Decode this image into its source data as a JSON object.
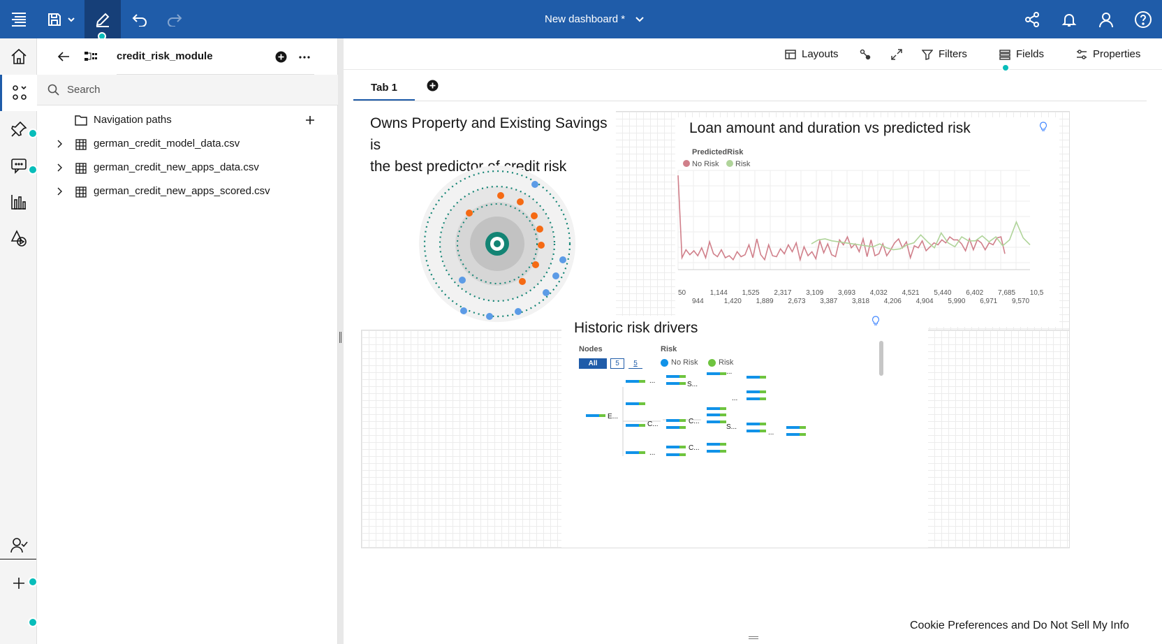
{
  "header": {
    "title": "New dashboard *"
  },
  "panel": {
    "module_name": "credit_risk_module",
    "search_placeholder": "Search",
    "tree": [
      {
        "label": "Navigation paths",
        "type": "folder"
      },
      {
        "label": "german_credit_model_data.csv",
        "type": "table"
      },
      {
        "label": "german_credit_new_apps_data.csv",
        "type": "table"
      },
      {
        "label": "german_credit_new_apps_scored.csv",
        "type": "table"
      }
    ]
  },
  "toolbar": {
    "layouts": "Layouts",
    "filters": "Filters",
    "fields": "Fields",
    "properties": "Properties"
  },
  "tabs": [
    {
      "label": "Tab 1",
      "selected": true
    }
  ],
  "widgets": {
    "insight": {
      "title_line1": "Owns Property and Existing Savings is",
      "title_line2": "the best predictor of credit risk"
    },
    "line_chart": {
      "title": "Loan amount and duration vs predicted risk",
      "legend_title": "PredictedRisk"
    },
    "drivers": {
      "title": "Historic risk drivers",
      "nodes_label": "Nodes",
      "risk_label": "Risk",
      "node_buttons": [
        "All",
        "5",
        "5"
      ],
      "legend": [
        "No Risk",
        "Risk"
      ],
      "node_labels": [
        "E...",
        "...",
        "C...",
        "...",
        "S...",
        "...",
        "C...",
        "C...",
        "...",
        "S...",
        "..."
      ]
    }
  },
  "chart_data": {
    "type": "line",
    "title": "Loan amount and duration vs predicted risk",
    "legend_title": "PredictedRisk",
    "legend_position": "top-left",
    "series": [
      {
        "name": "No Risk",
        "color": "#d07f8a",
        "values": [
          95,
          12,
          20,
          15,
          19,
          14,
          22,
          12,
          28,
          16,
          13,
          20,
          12,
          14,
          10,
          18,
          13,
          15,
          25,
          12,
          31,
          15,
          10,
          25,
          14,
          13,
          21,
          16,
          25,
          18,
          27,
          10,
          23,
          14,
          18,
          11,
          29,
          17,
          26,
          15,
          13,
          30,
          25,
          33,
          22,
          26,
          18,
          31,
          13,
          30,
          14,
          16,
          26,
          14,
          20,
          27,
          31,
          22,
          28,
          12,
          24,
          22,
          29,
          19,
          23,
          27,
          25,
          30,
          27,
          33,
          30,
          30,
          26,
          19,
          31,
          20,
          30,
          27,
          20,
          27,
          25,
          32,
          33,
          16
        ]
      },
      {
        "name": "Risk",
        "color": "#b0d49a",
        "values": [
          26,
          30,
          31,
          29,
          28,
          27,
          26,
          25,
          24,
          23,
          26,
          22,
          20,
          21,
          25,
          27,
          35,
          28,
          22,
          37,
          27,
          23,
          33,
          29,
          29,
          34,
          28,
          33,
          24,
          30,
          48,
          32,
          25
        ]
      }
    ],
    "x_tick_labels_top": [
      "50",
      "1,144",
      "1,525",
      "2,317",
      "3,109",
      "3,693",
      "4,032",
      "4,521",
      "5,440",
      "6,402",
      "7,685",
      "10,5"
    ],
    "x_tick_labels_bottom": [
      "944",
      "1,420",
      "1,889",
      "2,673",
      "3,387",
      "3,818",
      "4,206",
      "4,904",
      "5,990",
      "6,971",
      "9,570"
    ],
    "ylim": [
      0,
      100
    ],
    "grid": true
  },
  "footer": {
    "cookie_text": "Cookie Preferences and Do Not Sell My Info"
  }
}
